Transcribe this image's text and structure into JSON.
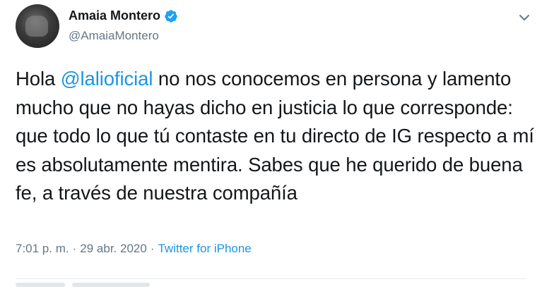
{
  "user": {
    "display_name": "Amaia Montero",
    "handle": "@AmaiaMontero",
    "verified": true
  },
  "tweet": {
    "text_before": "Hola ",
    "mention": "@lalioficial",
    "text_after": " no nos conocemos en persona y lamento mucho que no hayas dicho en justicia lo que corresponde: que todo lo que tú contaste en tu directo de IG respecto a mí es absolutamente mentira. Sabes que he querido de buena fe, a través de nuestra compañía"
  },
  "meta": {
    "time": "7:01 p. m.",
    "separator": "·",
    "date": "29 abr. 2020",
    "separator2": "·",
    "source": "Twitter for iPhone"
  },
  "icons": {
    "verified": "verified-badge-icon",
    "menu": "chevron-down-icon"
  },
  "colors": {
    "link": "#1b95e0",
    "secondary": "#657786",
    "verified": "#1da1f2"
  }
}
